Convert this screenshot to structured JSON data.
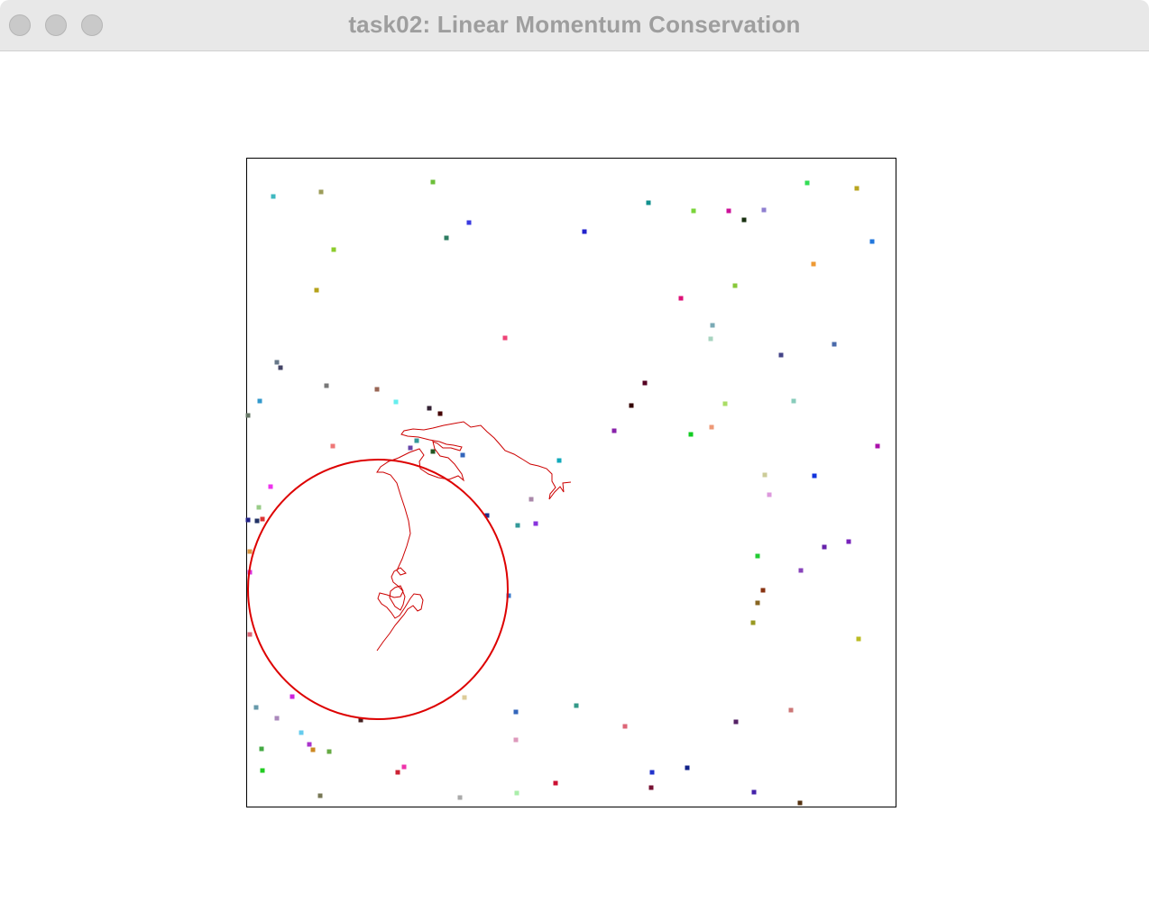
{
  "window": {
    "title": "task02: Linear Momentum Conservation",
    "buttons": [
      "close",
      "minimize",
      "zoom"
    ]
  },
  "simulation": {
    "border_color": "#000000",
    "big_particle_color": "#dd0000",
    "trail_color": "#cc0000",
    "particle_count": 98
  }
}
